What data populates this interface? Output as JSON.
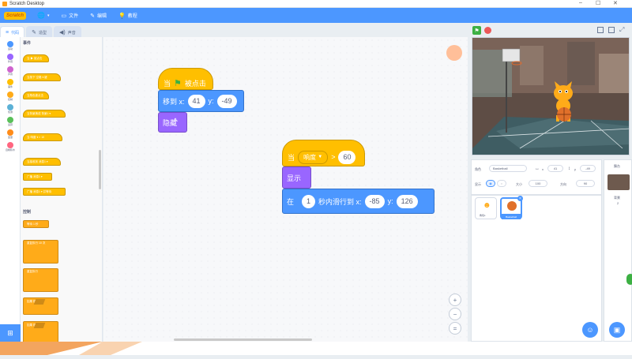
{
  "window": {
    "title": "Scratch Desktop",
    "controls": [
      "–",
      "☐",
      "✕"
    ]
  },
  "menubar": {
    "brand": "Scratch",
    "globe_icon": "globe-icon",
    "file_label": "文件",
    "edit_label": "编辑",
    "tutorials_label": "教程"
  },
  "tabs": [
    {
      "label": "代码",
      "icon": "code-icon",
      "active": true
    },
    {
      "label": "造型",
      "icon": "brush-icon",
      "active": false
    },
    {
      "label": "声音",
      "icon": "speaker-icon",
      "active": false
    }
  ],
  "categories": [
    {
      "label": "运动",
      "color": "#4c97ff"
    },
    {
      "label": "外观",
      "color": "#9966ff"
    },
    {
      "label": "声音",
      "color": "#cf63cf"
    },
    {
      "label": "事件",
      "color": "#ffbf00"
    },
    {
      "label": "控制",
      "color": "#ffab19"
    },
    {
      "label": "侦测",
      "color": "#5cb1d6"
    },
    {
      "label": "运算",
      "color": "#59c059"
    },
    {
      "label": "变量",
      "color": "#ff8c1a"
    },
    {
      "label": "自制积木",
      "color": "#ff6680"
    }
  ],
  "palette": {
    "events_heading": "事件",
    "control_heading": "控制",
    "event_blocks": [
      "当 ▶ 被点击",
      "当按下 空格 ▾ 键",
      "当角色被点击",
      "当背景换成 背景1 ▾",
      "当 响度 ▾ > 10",
      "当接收到 消息1 ▾",
      "广播 消息1 ▾",
      "广播 消息1 ▾ 并等待"
    ],
    "control_wait": "等待 1 秒",
    "control_repeat": "重复执行 10 次",
    "control_forever": "重复执行",
    "control_if": "如果 那么",
    "control_if_else": "如果 那么"
  },
  "script1": {
    "hat_when": "当",
    "hat_clicked": "被点击",
    "goto_label": "移到 x:",
    "goto_x": "41",
    "y_label": "y:",
    "goto_y": "-49",
    "hide_label": "隐藏"
  },
  "script2": {
    "hat_when": "当",
    "sensor_option": "响度",
    "operator": ">",
    "threshold": "60",
    "show_label": "显示",
    "glide_in": "在",
    "glide_secs": "1",
    "glide_mid": "秒内滑行到 x:",
    "glide_x": "-85",
    "y_label": "y:",
    "glide_y": "126"
  },
  "zoom": {
    "in": "+",
    "out": "−",
    "reset": "="
  },
  "sprite_info": {
    "sprite_label": "角色",
    "sprite_name": "Basketball",
    "x_label": "x",
    "x_value": "41",
    "y_label": "y",
    "y_value": "-49",
    "show_label": "显示",
    "size_label": "大小",
    "size_value": "100",
    "direction_label": "方向",
    "direction_value": "90"
  },
  "sprites": [
    {
      "name": "角色1",
      "selected": false
    },
    {
      "name": "Basketball",
      "selected": true
    }
  ],
  "stage_panel": {
    "title": "舞台",
    "backdrops_label": "背景",
    "backdrops_count": "2"
  }
}
